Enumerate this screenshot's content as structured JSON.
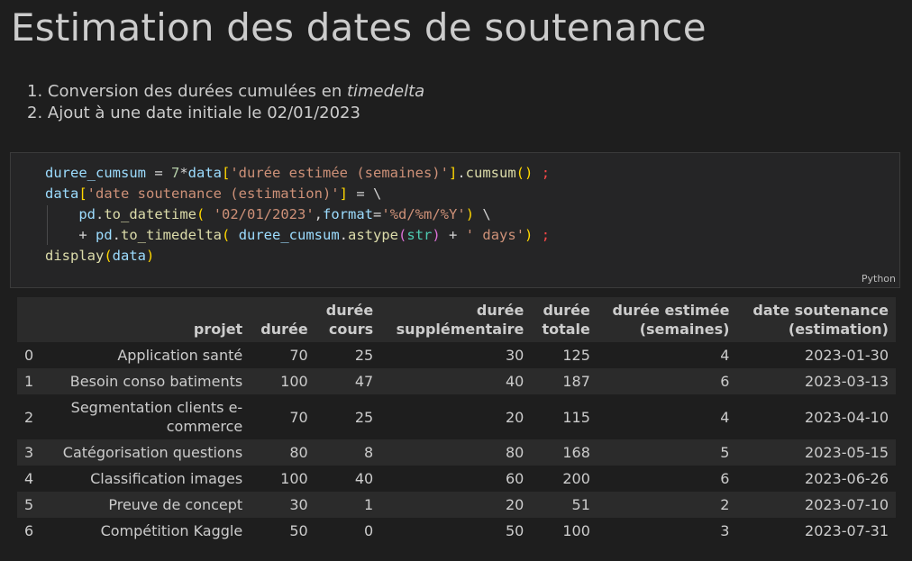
{
  "heading": "Estimation des dates de soutenance",
  "steps": [
    {
      "number": "1.",
      "text": "Conversion des durées cumulées en ",
      "emphasis": "timedelta"
    },
    {
      "number": "2.",
      "text": "Ajout à une date initiale le 02/01/2023"
    }
  ],
  "code_cell": {
    "language": "Python",
    "lines": [
      "duree_cumsum = 7*data['durée estimée (semaines)'].cumsum() ;",
      "data['date soutenance (estimation)'] = \\",
      "    pd.to_datetime( '02/01/2023',format='%d/%m/%Y') \\",
      "    + pd.to_timedelta( duree_cumsum.astype(str) + ' days') ;",
      "display(data)"
    ]
  },
  "table": {
    "headers": [
      "",
      "projet",
      "durée",
      "durée cours",
      "durée supplémentaire",
      "durée totale",
      "durée estimée (semaines)",
      "date soutenance (estimation)"
    ],
    "header_lines": [
      [
        "",
        ""
      ],
      [
        "",
        "projet"
      ],
      [
        "",
        "durée"
      ],
      [
        "durée",
        "cours"
      ],
      [
        "durée",
        "supplémentaire"
      ],
      [
        "durée",
        "totale"
      ],
      [
        "durée estimée",
        "(semaines)"
      ],
      [
        "date soutenance",
        "(estimation)"
      ]
    ],
    "rows": [
      {
        "index": "0",
        "projet": [
          "Application santé"
        ],
        "duree": "70",
        "duree_cours": "25",
        "duree_supp": "30",
        "duree_totale": "125",
        "semaines": "4",
        "date": "2023-01-30"
      },
      {
        "index": "1",
        "projet": [
          "Besoin conso batiments"
        ],
        "duree": "100",
        "duree_cours": "47",
        "duree_supp": "40",
        "duree_totale": "187",
        "semaines": "6",
        "date": "2023-03-13"
      },
      {
        "index": "2",
        "projet": [
          "Segmentation clients e-",
          "commerce"
        ],
        "duree": "70",
        "duree_cours": "25",
        "duree_supp": "20",
        "duree_totale": "115",
        "semaines": "4",
        "date": "2023-04-10"
      },
      {
        "index": "3",
        "projet": [
          "Catégorisation questions"
        ],
        "duree": "80",
        "duree_cours": "8",
        "duree_supp": "80",
        "duree_totale": "168",
        "semaines": "5",
        "date": "2023-05-15"
      },
      {
        "index": "4",
        "projet": [
          "Classification images"
        ],
        "duree": "100",
        "duree_cours": "40",
        "duree_supp": "60",
        "duree_totale": "200",
        "semaines": "6",
        "date": "2023-06-26"
      },
      {
        "index": "5",
        "projet": [
          "Preuve de concept"
        ],
        "duree": "30",
        "duree_cours": "1",
        "duree_supp": "20",
        "duree_totale": "51",
        "semaines": "2",
        "date": "2023-07-10"
      },
      {
        "index": "6",
        "projet": [
          "Compétition Kaggle"
        ],
        "duree": "50",
        "duree_cours": "0",
        "duree_supp": "50",
        "duree_totale": "100",
        "semaines": "3",
        "date": "2023-07-31"
      }
    ]
  }
}
